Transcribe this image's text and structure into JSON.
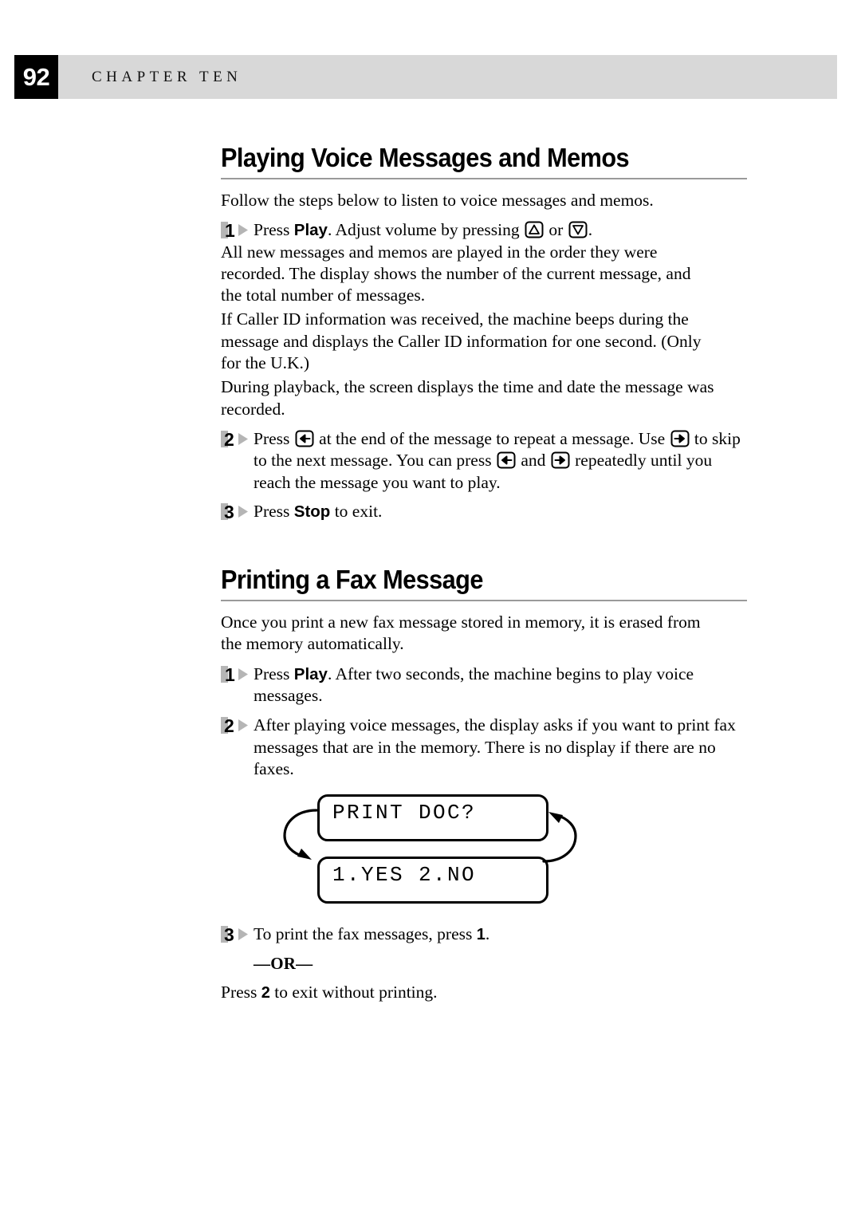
{
  "header": {
    "page_number": "92",
    "chapter_label": "CHAPTER TEN"
  },
  "sections": [
    {
      "heading": "Playing Voice Messages and Memos",
      "intro": "Follow the steps below to listen to voice messages and memos.",
      "steps": [
        {
          "number": "1",
          "text_before": "Press ",
          "bold": "Play",
          "text_middle": ". Adjust volume by pressing ",
          "icon_1": "arrow-up-key-icon",
          "text_between": " or ",
          "icon_2": "arrow-down-key-icon",
          "text_after": ".",
          "paragraphs": [
            "All new messages and memos are played in the order they were recorded. The display shows the number of the current message, and the total number of messages.",
            "If Caller ID information was received, the machine beeps during the message and displays the Caller ID information for one second. (Only for the U.K.)",
            "During playback, the screen displays the time and date the message was recorded."
          ]
        },
        {
          "number": "2",
          "part_1": "Press ",
          "icon_1": "arrow-left-key-icon",
          "part_2": " at the end of the message to repeat a message. Use ",
          "icon_2": "arrow-right-key-icon",
          "part_3": " to skip to the next message. You can press ",
          "icon_3": "arrow-left-key-icon",
          "part_4": " and ",
          "icon_4": "arrow-right-key-icon",
          "part_5": " repeatedly until you reach the message you want to play."
        },
        {
          "number": "3",
          "text_before": "Press ",
          "bold": "Stop",
          "text_after": " to exit."
        }
      ]
    },
    {
      "heading": "Printing a Fax Message",
      "intro": "Once you print a new fax message stored in memory, it is erased from the memory automatically.",
      "steps": [
        {
          "number": "1",
          "text_before": "Press ",
          "bold": "Play",
          "text_after": ". After two seconds, the machine begins to play voice messages."
        },
        {
          "number": "2",
          "text": "After playing voice messages, the display asks if you want to print fax messages that are in the memory. There is no display if there are no faxes."
        },
        {
          "number": "3",
          "text_before": "To print the fax messages, press ",
          "bold": "1",
          "text_after": "."
        }
      ],
      "lcd": {
        "line_1": "PRINT DOC?",
        "line_2": "1.YES 2.NO"
      },
      "or_divider": "—OR—",
      "alt_action_before": "Press ",
      "alt_action_bold": "2",
      "alt_action_after": " to exit without printing."
    }
  ]
}
